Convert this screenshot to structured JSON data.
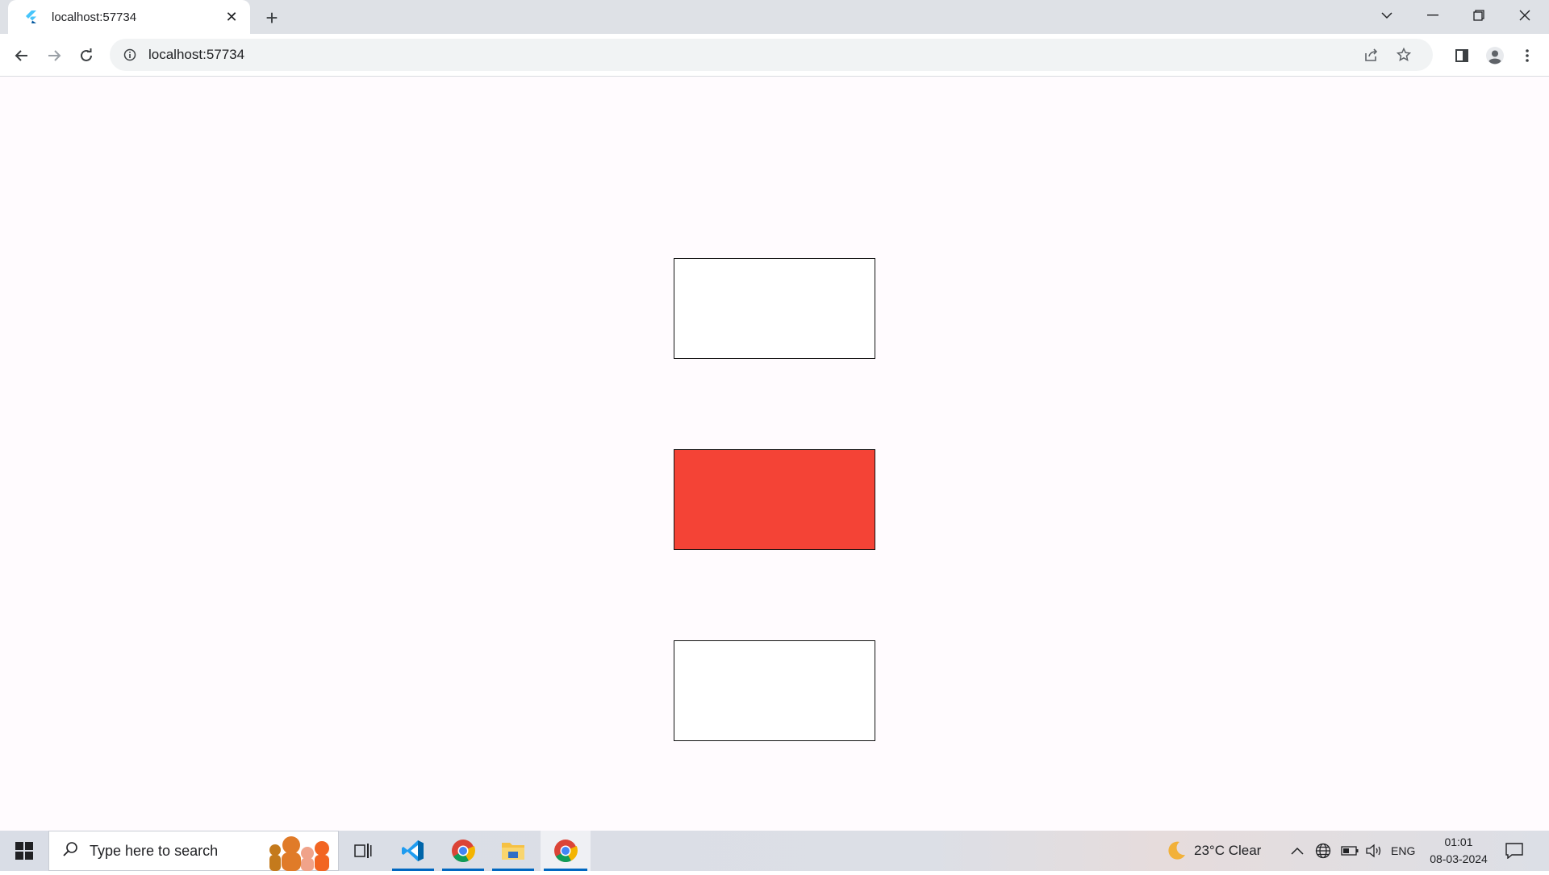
{
  "browser": {
    "tab_title": "localhost:57734",
    "url": "localhost:57734"
  },
  "page": {
    "background": "#fffbfe",
    "boxes": [
      {
        "fill": "#ffffff",
        "border": "#111111"
      },
      {
        "fill": "#f44336",
        "border": "#111111"
      },
      {
        "fill": "#ffffff",
        "border": "#111111"
      }
    ]
  },
  "taskbar": {
    "search_placeholder": "Type here to search",
    "weather": "23°C  Clear",
    "language": "ENG",
    "time": "01:01",
    "date": "08-03-2024",
    "apps": [
      "task-view",
      "vscode",
      "chrome",
      "file-explorer",
      "chrome-active"
    ]
  }
}
